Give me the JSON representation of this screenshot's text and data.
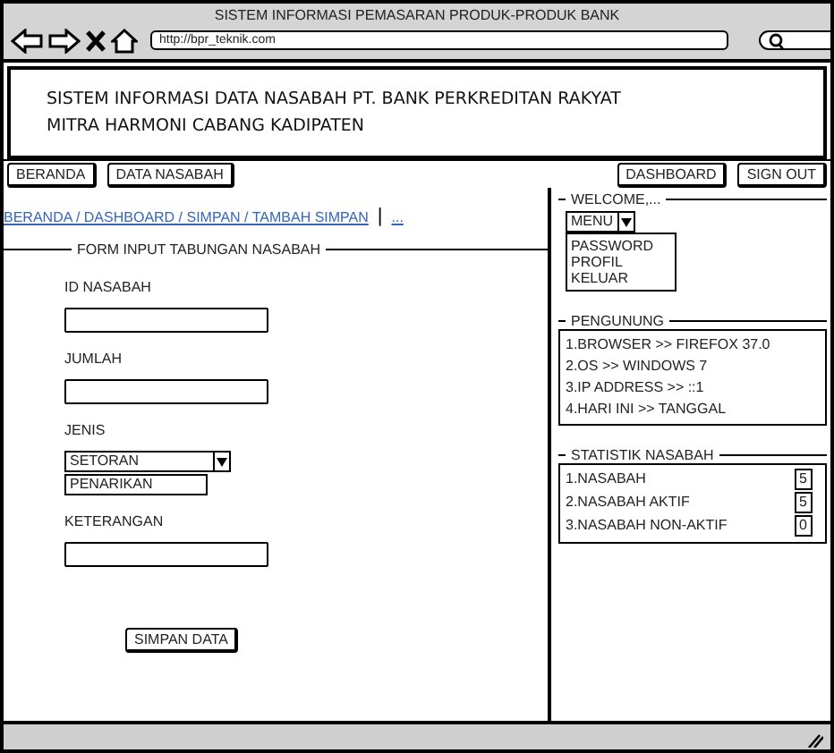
{
  "browser": {
    "title": "SISTEM INFORMASI PEMASARAN PRODUK-PRODUK BANK",
    "url": "http://bpr_teknik.com"
  },
  "header": {
    "lines": [
      "SISTEM INFORMASI DATA NASABAH PT. BANK PERKREDITAN  RAKYAT",
      "MITRA HARMONI CABANG KADIPATEN"
    ]
  },
  "nav_left": [
    "BERANDA",
    "DATA NASABAH"
  ],
  "nav_right": [
    "DASHBOARD",
    "SIGN OUT"
  ],
  "breadcrumb": {
    "path": "BERANDA / DASHBOARD / SIMPAN / TAMBAH SIMPAN",
    "separator": "|",
    "more": "..."
  },
  "form": {
    "legend": "FORM INPUT TABUNGAN NASABAH",
    "fields": [
      {
        "kind": "text",
        "label": "ID NASABAH"
      },
      {
        "kind": "text",
        "label": "JUMLAH"
      },
      {
        "kind": "select",
        "label": "JENIS",
        "value": "SETORAN",
        "options": [
          "PENARIKAN"
        ]
      },
      {
        "kind": "text",
        "label": "KETERANGAN"
      }
    ],
    "submit": "SIMPAN DATA"
  },
  "welcome": {
    "legend": "WELCOME,...",
    "menu": "MENU",
    "menu_items": [
      "PASSWORD",
      "PROFIL",
      "KELUAR"
    ]
  },
  "visitor": {
    "legend": "PENGUNUNG",
    "items": [
      "1.BROWSER >> FIREFOX 37.0",
      "2.OS >> WINDOWS 7",
      "3.IP ADDRESS >> ::1",
      "4.HARI INI >> TANGGAL"
    ]
  },
  "stats": {
    "legend": "STATISTIK NASABAH",
    "rows": [
      {
        "label": "1.NASABAH",
        "value": "5"
      },
      {
        "label": "2.NASABAH AKTIF",
        "value": "5"
      },
      {
        "label": "3.NASABAH NON-AKTIF",
        "value": "0"
      }
    ]
  }
}
